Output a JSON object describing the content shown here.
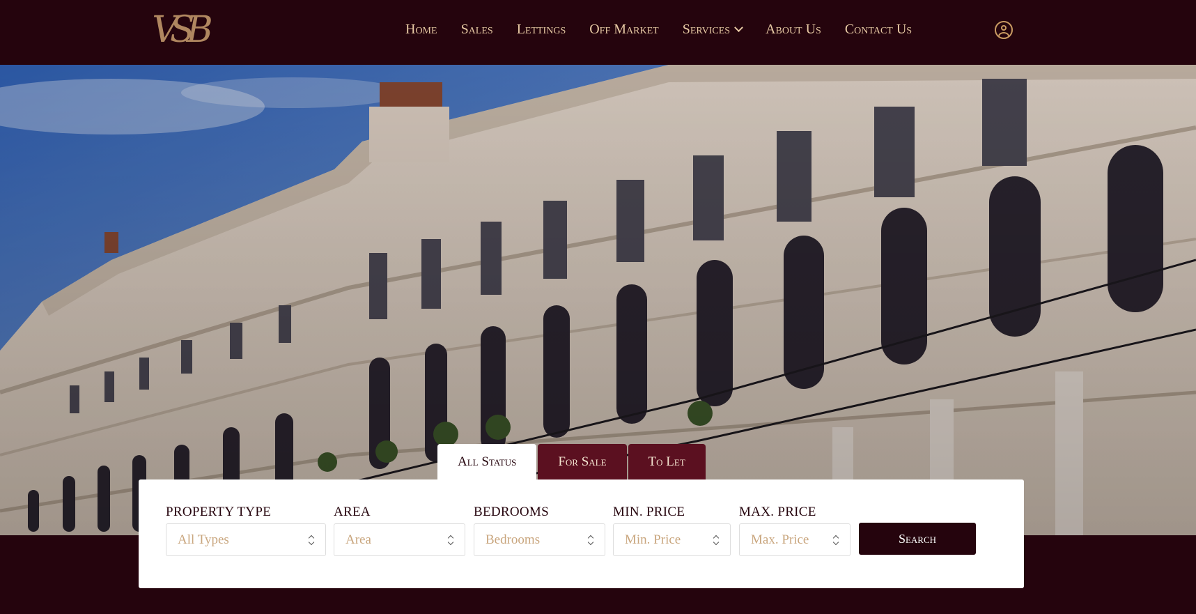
{
  "brand": {
    "logo_text": "VSB"
  },
  "nav": {
    "items": [
      "Home",
      "Sales",
      "Lettings",
      "Off Market",
      "Services",
      "About Us",
      "Contact Us"
    ]
  },
  "icons": {
    "account": "user-circle-icon",
    "dropdown": "chevron-down-icon",
    "select": "up-down-arrows-icon"
  },
  "colors": {
    "brand_dark": "#25040d",
    "accent_gold": "#e7c9a4",
    "tab_inactive": "#5b1020"
  },
  "search": {
    "tabs": [
      {
        "label": "All Status",
        "active": true
      },
      {
        "label": "For Sale",
        "active": false
      },
      {
        "label": "To Let",
        "active": false
      }
    ],
    "fields": [
      {
        "label": "Property Type",
        "placeholder": "All Types"
      },
      {
        "label": "Area",
        "placeholder": "Area"
      },
      {
        "label": "Bedrooms",
        "placeholder": "Bedrooms"
      },
      {
        "label": "Min. Price",
        "placeholder": "Min. Price"
      },
      {
        "label": "Max. Price",
        "placeholder": "Max. Price"
      }
    ],
    "button_label": "Search"
  }
}
